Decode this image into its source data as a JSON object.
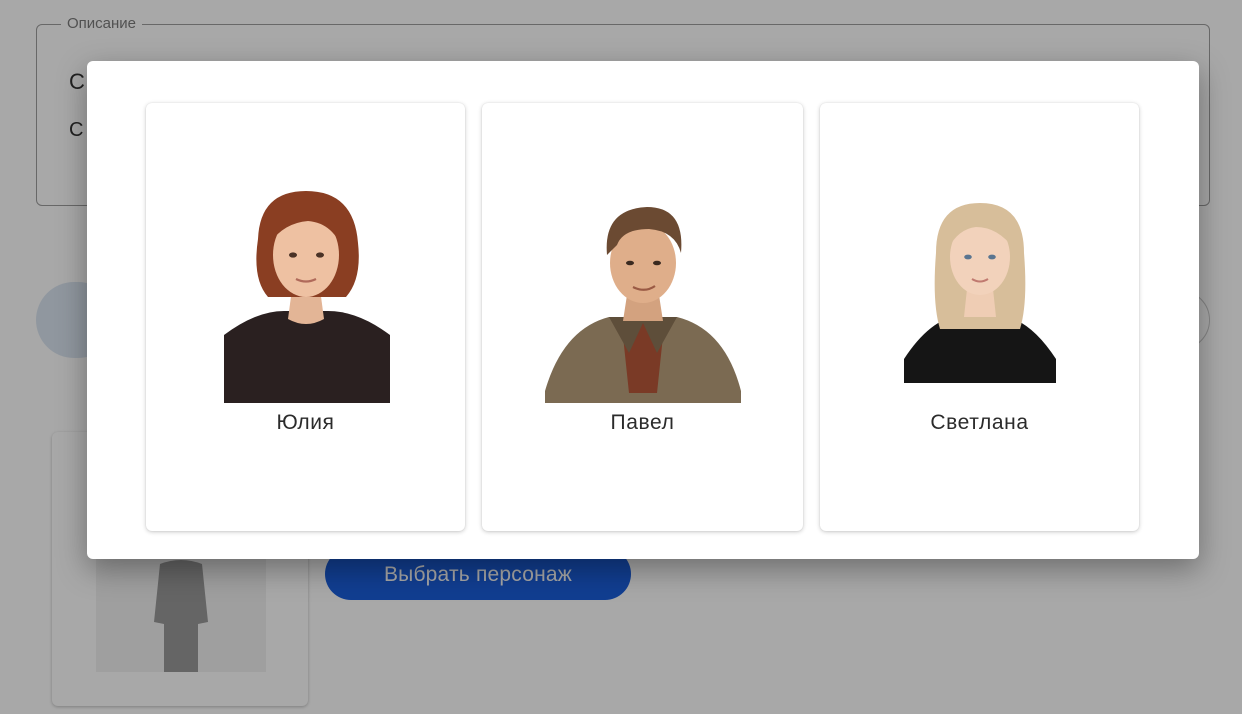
{
  "background": {
    "description_field": {
      "legend": "Описание",
      "line1": "С",
      "line2": "С"
    },
    "select_button_label": "Выбрать персонаж"
  },
  "modal": {
    "personas": [
      {
        "name": "Юлия",
        "icon": "female-portrait-short-hair"
      },
      {
        "name": "Павел",
        "icon": "male-portrait-jacket"
      },
      {
        "name": "Светлана",
        "icon": "female-portrait-blonde"
      }
    ]
  },
  "colors": {
    "accent": "#1a5fdc",
    "backdrop": "#000000"
  }
}
